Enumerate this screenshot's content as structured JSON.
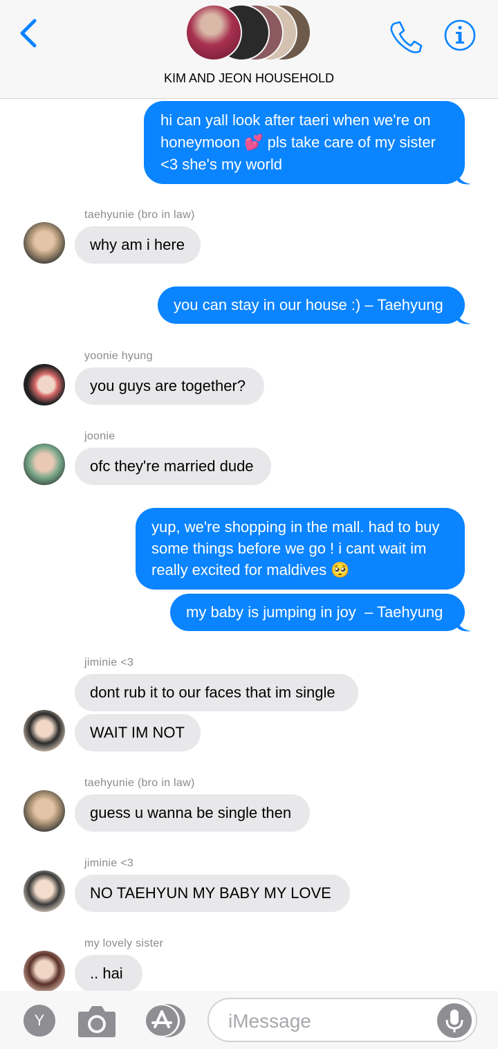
{
  "header": {
    "title": "KIM AND JEON HOUSEHOLD",
    "back_icon": "chevron-left-icon",
    "call_icon": "phone-icon",
    "info_icon": "info-icon",
    "accent": "#0a84ff"
  },
  "messages": [
    {
      "type": "sent",
      "text": "hi can yall look after taeri when we're on\nhoneymoon 💕 pls take care of my sister\n<3 she's my world"
    },
    {
      "type": "recv",
      "sender": "taehyunie (bro in law)",
      "text": "why am i here"
    },
    {
      "type": "sent",
      "text": "you can stay in our house :) – Taehyung"
    },
    {
      "type": "recv",
      "sender": "yoonie hyung",
      "text": "you guys are together?"
    },
    {
      "type": "recv",
      "sender": "joonie",
      "text": "ofc they're married dude"
    },
    {
      "type": "sent",
      "text": "yup, we're shopping in the mall. had to buy\nsome things before we go ! i cant wait im\nreally excited for maldives 🥺"
    },
    {
      "type": "sent",
      "text": "my baby is jumping in joy  – Taehyung"
    },
    {
      "type": "recv",
      "sender": "jiminie <3",
      "text": "dont rub it to our faces that im single"
    },
    {
      "type": "recv",
      "text": "WAIT IM NOT"
    },
    {
      "type": "recv",
      "sender": "taehyunie (bro in law)",
      "text": "guess u wanna be single then"
    },
    {
      "type": "recv",
      "sender": "jiminie <3",
      "text": "NO TAEHYUN MY BABY MY LOVE"
    },
    {
      "type": "recv",
      "sender": "my lovely sister",
      "text": ".. hai"
    }
  ],
  "composer": {
    "apps_label": "Y",
    "camera_icon": "camera-icon",
    "appstore_icon": "app-store-icon",
    "placeholder": "iMessage",
    "mic_icon": "microphone-icon"
  }
}
